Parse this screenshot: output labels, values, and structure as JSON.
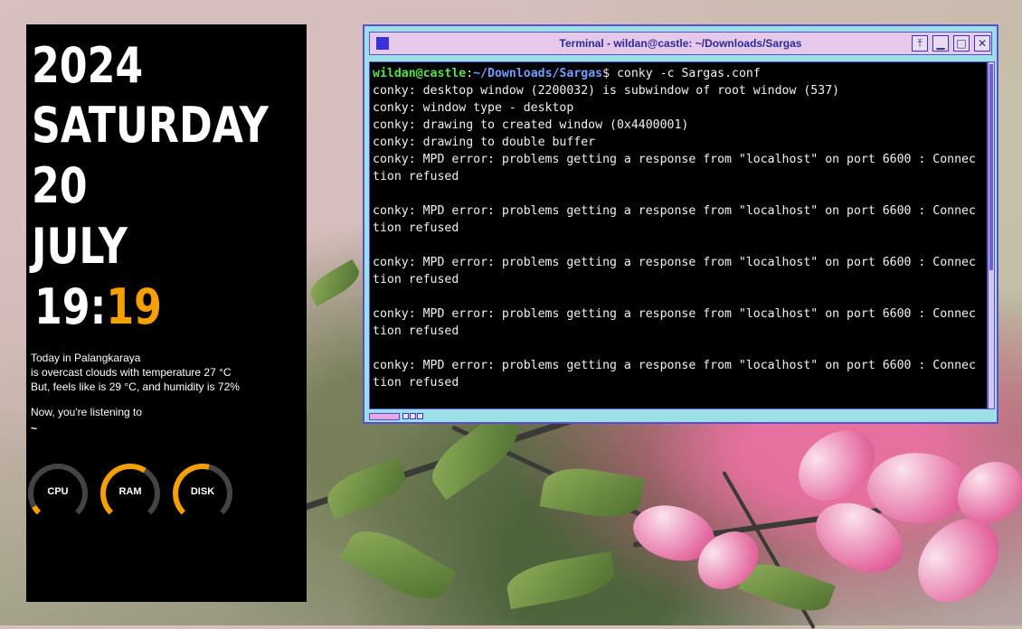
{
  "conky": {
    "year": "2024",
    "weekday": "SATURDAY",
    "day": "20",
    "month": "JULY",
    "time_hour": "19:",
    "time_minute": "19",
    "weather_line1": "Today in Palangkaraya",
    "weather_line2": "is overcast clouds with temperature 27 °C",
    "weather_line3": "But, feels like is 29 °C, and humidity is 72%",
    "music_label": "Now, you're listening to",
    "music_track": "~",
    "gauges": [
      {
        "label": "CPU",
        "value": 0.06
      },
      {
        "label": "RAM",
        "value": 0.62
      },
      {
        "label": "DISK",
        "value": 0.55
      }
    ],
    "accent": "#f5a000"
  },
  "terminal": {
    "title": "Terminal - wildan@castle: ~/Downloads/Sargas",
    "prompt_user": "wildan@castle",
    "prompt_sep": ":",
    "prompt_path": "~/Downloads/Sargas",
    "prompt_symbol": "$",
    "command": " conky -c Sargas.conf",
    "output_lines": [
      "conky: desktop window (2200032) is subwindow of root window (537)",
      "conky: window type - desktop",
      "conky: drawing to created window (0x4400001)",
      "conky: drawing to double buffer",
      "conky: MPD error: problems getting a response from \"localhost\" on port 6600 : Connec",
      "tion refused",
      "",
      "conky: MPD error: problems getting a response from \"localhost\" on port 6600 : Connec",
      "tion refused",
      "",
      "conky: MPD error: problems getting a response from \"localhost\" on port 6600 : Connec",
      "tion refused",
      "",
      "conky: MPD error: problems getting a response from \"localhost\" on port 6600 : Connec",
      "tion refused",
      "",
      "conky: MPD error: problems getting a response from \"localhost\" on port 6600 : Connec",
      "tion refused"
    ],
    "buttons": [
      "stick-icon",
      "minimize-icon",
      "maximize-icon",
      "close-icon"
    ],
    "colors": {
      "frame": "#9ae0e6",
      "border": "#5a4fd0",
      "titlebar": "#e6c8ea"
    }
  }
}
